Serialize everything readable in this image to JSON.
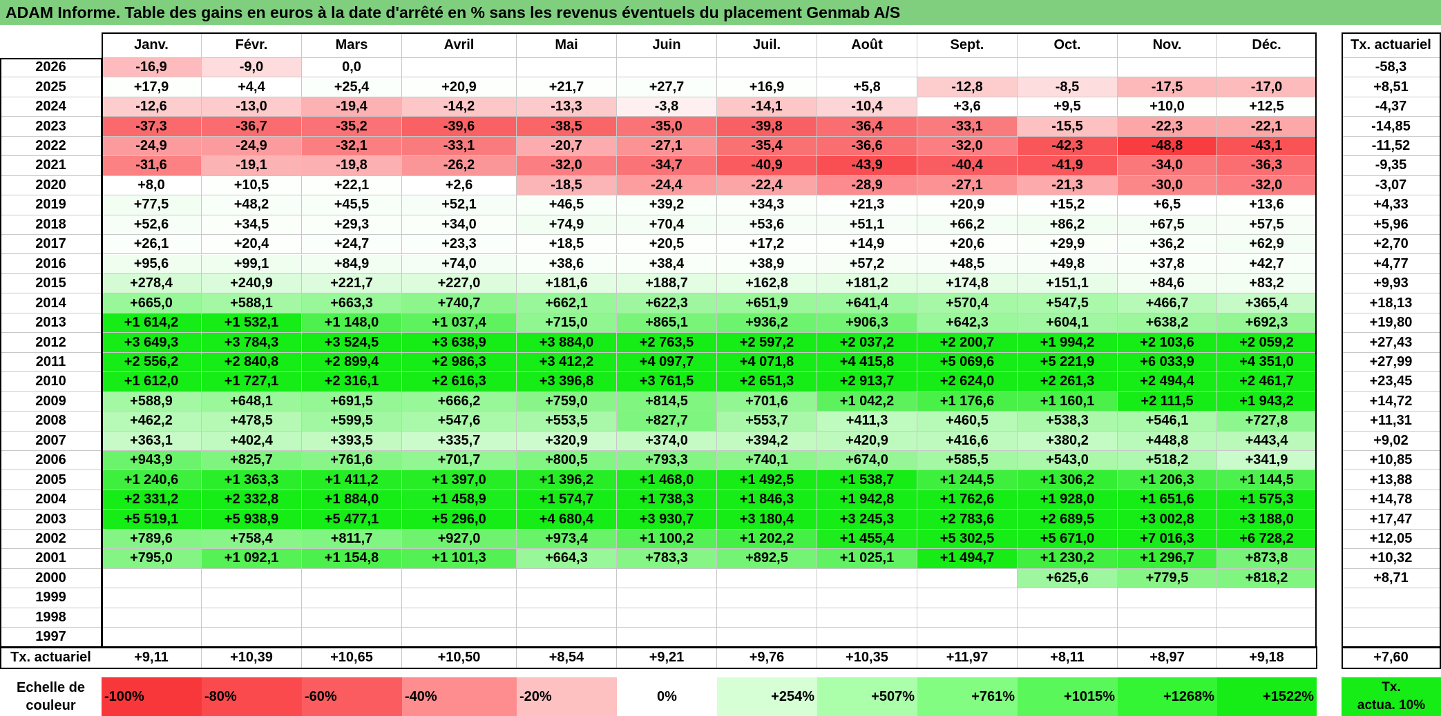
{
  "title": "ADAM Informe. Table des gains en euros à la date d'arrêté en % sans les revenus éventuels du placement Genmab A/S",
  "months": [
    "Janv.",
    "Févr.",
    "Mars",
    "Avril",
    "Mai",
    "Juin",
    "Juil.",
    "Août",
    "Sept.",
    "Oct.",
    "Nov.",
    "Déc."
  ],
  "rate_header": "Tx. actuariel",
  "rows": [
    {
      "year": "2026",
      "v": [
        "-16,9",
        "-9,0",
        "0,0",
        "",
        "",
        "",
        "",
        "",
        "",
        "",
        "",
        ""
      ],
      "rate": "-58,3"
    },
    {
      "year": "2025",
      "v": [
        "+17,9",
        "+4,4",
        "+25,4",
        "+20,9",
        "+21,7",
        "+27,7",
        "+16,9",
        "+5,8",
        "-12,8",
        "-8,5",
        "-17,5",
        "-17,0"
      ],
      "rate": "+8,51"
    },
    {
      "year": "2024",
      "v": [
        "-12,6",
        "-13,0",
        "-19,4",
        "-14,2",
        "-13,3",
        "-3,8",
        "-14,1",
        "-10,4",
        "+3,6",
        "+9,5",
        "+10,0",
        "+12,5"
      ],
      "rate": "-4,37"
    },
    {
      "year": "2023",
      "v": [
        "-37,3",
        "-36,7",
        "-35,2",
        "-39,6",
        "-38,5",
        "-35,0",
        "-39,8",
        "-36,4",
        "-33,1",
        "-15,5",
        "-22,3",
        "-22,1"
      ],
      "rate": "-14,85"
    },
    {
      "year": "2022",
      "v": [
        "-24,9",
        "-24,9",
        "-32,1",
        "-33,1",
        "-20,7",
        "-27,1",
        "-35,4",
        "-36,6",
        "-32,0",
        "-42,3",
        "-48,8",
        "-43,1"
      ],
      "rate": "-11,52"
    },
    {
      "year": "2021",
      "v": [
        "-31,6",
        "-19,1",
        "-19,8",
        "-26,2",
        "-32,0",
        "-34,7",
        "-40,9",
        "-43,9",
        "-40,4",
        "-41,9",
        "-34,0",
        "-36,3"
      ],
      "rate": "-9,35"
    },
    {
      "year": "2020",
      "v": [
        "+8,0",
        "+10,5",
        "+22,1",
        "+2,6",
        "-18,5",
        "-24,4",
        "-22,4",
        "-28,9",
        "-27,1",
        "-21,3",
        "-30,0",
        "-32,0"
      ],
      "rate": "-3,07"
    },
    {
      "year": "2019",
      "v": [
        "+77,5",
        "+48,2",
        "+45,5",
        "+52,1",
        "+46,5",
        "+39,2",
        "+34,3",
        "+21,3",
        "+20,9",
        "+15,2",
        "+6,5",
        "+13,6"
      ],
      "rate": "+4,33"
    },
    {
      "year": "2018",
      "v": [
        "+52,6",
        "+34,5",
        "+29,3",
        "+34,0",
        "+74,9",
        "+70,4",
        "+53,6",
        "+51,1",
        "+66,2",
        "+86,2",
        "+67,5",
        "+57,5"
      ],
      "rate": "+5,96"
    },
    {
      "year": "2017",
      "v": [
        "+26,1",
        "+20,4",
        "+24,7",
        "+23,3",
        "+18,5",
        "+20,5",
        "+17,2",
        "+14,9",
        "+20,6",
        "+29,9",
        "+36,2",
        "+62,9"
      ],
      "rate": "+2,70"
    },
    {
      "year": "2016",
      "v": [
        "+95,6",
        "+99,1",
        "+84,9",
        "+74,0",
        "+38,6",
        "+38,4",
        "+38,9",
        "+57,2",
        "+48,5",
        "+49,8",
        "+37,8",
        "+42,7"
      ],
      "rate": "+4,77"
    },
    {
      "year": "2015",
      "v": [
        "+278,4",
        "+240,9",
        "+221,7",
        "+227,0",
        "+181,6",
        "+188,7",
        "+162,8",
        "+181,2",
        "+174,8",
        "+151,1",
        "+84,6",
        "+83,2"
      ],
      "rate": "+9,93"
    },
    {
      "year": "2014",
      "v": [
        "+665,0",
        "+588,1",
        "+663,3",
        "+740,7",
        "+662,1",
        "+622,3",
        "+651,9",
        "+641,4",
        "+570,4",
        "+547,5",
        "+466,7",
        "+365,4"
      ],
      "rate": "+18,13"
    },
    {
      "year": "2013",
      "v": [
        "+1 614,2",
        "+1 532,1",
        "+1 148,0",
        "+1 037,4",
        "+715,0",
        "+865,1",
        "+936,2",
        "+906,3",
        "+642,3",
        "+604,1",
        "+638,2",
        "+692,3"
      ],
      "rate": "+19,80"
    },
    {
      "year": "2012",
      "v": [
        "+3 649,3",
        "+3 784,3",
        "+3 524,5",
        "+3 638,9",
        "+3 884,0",
        "+2 763,5",
        "+2 597,2",
        "+2 037,2",
        "+2 200,7",
        "+1 994,2",
        "+2 103,6",
        "+2 059,2"
      ],
      "rate": "+27,43"
    },
    {
      "year": "2011",
      "v": [
        "+2 556,2",
        "+2 840,8",
        "+2 899,4",
        "+2 986,3",
        "+3 412,2",
        "+4 097,7",
        "+4 071,8",
        "+4 415,8",
        "+5 069,6",
        "+5 221,9",
        "+6 033,9",
        "+4 351,0"
      ],
      "rate": "+27,99"
    },
    {
      "year": "2010",
      "v": [
        "+1 612,0",
        "+1 727,1",
        "+2 316,1",
        "+2 616,3",
        "+3 396,8",
        "+3 761,5",
        "+2 651,3",
        "+2 913,7",
        "+2 624,0",
        "+2 261,3",
        "+2 494,4",
        "+2 461,7"
      ],
      "rate": "+23,45"
    },
    {
      "year": "2009",
      "v": [
        "+588,9",
        "+648,1",
        "+691,5",
        "+666,2",
        "+759,0",
        "+814,5",
        "+701,6",
        "+1 042,2",
        "+1 176,6",
        "+1 160,1",
        "+2 111,5",
        "+1 943,2"
      ],
      "rate": "+14,72"
    },
    {
      "year": "2008",
      "v": [
        "+462,2",
        "+478,5",
        "+599,5",
        "+547,6",
        "+553,5",
        "+827,7",
        "+553,7",
        "+411,3",
        "+460,5",
        "+538,3",
        "+546,1",
        "+727,8"
      ],
      "rate": "+11,31"
    },
    {
      "year": "2007",
      "v": [
        "+363,1",
        "+402,4",
        "+393,5",
        "+335,7",
        "+320,9",
        "+374,0",
        "+394,2",
        "+420,9",
        "+416,6",
        "+380,2",
        "+448,8",
        "+443,4"
      ],
      "rate": "+9,02"
    },
    {
      "year": "2006",
      "v": [
        "+943,9",
        "+825,7",
        "+761,6",
        "+701,7",
        "+800,5",
        "+793,3",
        "+740,1",
        "+674,0",
        "+585,5",
        "+543,0",
        "+518,2",
        "+341,9"
      ],
      "rate": "+10,85"
    },
    {
      "year": "2005",
      "v": [
        "+1 240,6",
        "+1 363,3",
        "+1 411,2",
        "+1 397,0",
        "+1 396,2",
        "+1 468,0",
        "+1 492,5",
        "+1 538,7",
        "+1 244,5",
        "+1 306,2",
        "+1 206,3",
        "+1 144,5"
      ],
      "rate": "+13,88"
    },
    {
      "year": "2004",
      "v": [
        "+2 331,2",
        "+2 332,8",
        "+1 884,0",
        "+1 458,9",
        "+1 574,7",
        "+1 738,3",
        "+1 846,3",
        "+1 942,8",
        "+1 762,6",
        "+1 928,0",
        "+1 651,6",
        "+1 575,3"
      ],
      "rate": "+14,78"
    },
    {
      "year": "2003",
      "v": [
        "+5 519,1",
        "+5 938,9",
        "+5 477,1",
        "+5 296,0",
        "+4 680,4",
        "+3 930,7",
        "+3 180,4",
        "+3 245,3",
        "+2 783,6",
        "+2 689,5",
        "+3 002,8",
        "+3 188,0"
      ],
      "rate": "+17,47"
    },
    {
      "year": "2002",
      "v": [
        "+789,6",
        "+758,4",
        "+811,7",
        "+927,0",
        "+973,4",
        "+1 100,2",
        "+1 202,2",
        "+1 455,4",
        "+5 302,5",
        "+5 671,0",
        "+7 016,3",
        "+6 728,2"
      ],
      "rate": "+12,05"
    },
    {
      "year": "2001",
      "v": [
        "+795,0",
        "+1 092,1",
        "+1 154,8",
        "+1 101,3",
        "+664,3",
        "+783,3",
        "+892,5",
        "+1 025,1",
        "+1 494,7",
        "+1 230,2",
        "+1 296,7",
        "+873,8"
      ],
      "rate": "+10,32"
    },
    {
      "year": "2000",
      "v": [
        "",
        "",
        "",
        "",
        "",
        "",
        "",
        "",
        "",
        "+625,6",
        "+779,5",
        "+818,2"
      ],
      "rate": "+8,71"
    },
    {
      "year": "1999",
      "v": [
        "",
        "",
        "",
        "",
        "",
        "",
        "",
        "",
        "",
        "",
        "",
        ""
      ],
      "rate": ""
    },
    {
      "year": "1998",
      "v": [
        "",
        "",
        "",
        "",
        "",
        "",
        "",
        "",
        "",
        "",
        "",
        ""
      ],
      "rate": ""
    },
    {
      "year": "1997",
      "v": [
        "",
        "",
        "",
        "",
        "",
        "",
        "",
        "",
        "",
        "",
        "",
        ""
      ],
      "rate": ""
    }
  ],
  "footer": {
    "label": "Tx. actuariel",
    "values": [
      "+9,11",
      "+10,39",
      "+10,65",
      "+10,50",
      "+8,54",
      "+9,21",
      "+9,76",
      "+10,35",
      "+11,97",
      "+8,11",
      "+8,97",
      "+9,18"
    ],
    "overall": "+7,60"
  },
  "scale": {
    "label_line1": "Echelle de",
    "label_line2": "couleur",
    "items": [
      {
        "text": "-100%",
        "color": "#f8373b",
        "align": "left"
      },
      {
        "text": "-80%",
        "color": "#fa4a4e",
        "align": "left"
      },
      {
        "text": "-60%",
        "color": "#fb5c60",
        "align": "left"
      },
      {
        "text": "-40%",
        "color": "#fd8d8f",
        "align": "left"
      },
      {
        "text": "-20%",
        "color": "#fdc1c2",
        "align": "left"
      },
      {
        "text": "0%",
        "color": "#ffffff",
        "align": "center"
      },
      {
        "text": "+254%",
        "color": "#d6ffd6",
        "align": "right"
      },
      {
        "text": "+507%",
        "color": "#abffab",
        "align": "right"
      },
      {
        "text": "+761%",
        "color": "#82fd82",
        "align": "right"
      },
      {
        "text": "+1015%",
        "color": "#5af75a",
        "align": "right"
      },
      {
        "text": "+1268%",
        "color": "#33f533",
        "align": "right"
      },
      {
        "text": "+1522%",
        "color": "#16ec16",
        "align": "right"
      }
    ],
    "legend_line1": "Tx.",
    "legend_line2": "actua. 10%",
    "legend_color": "#16ec16"
  },
  "colors": {
    "title_bg": "#7fcf7f",
    "border": "#000000",
    "grid": "#c8c8c8"
  }
}
